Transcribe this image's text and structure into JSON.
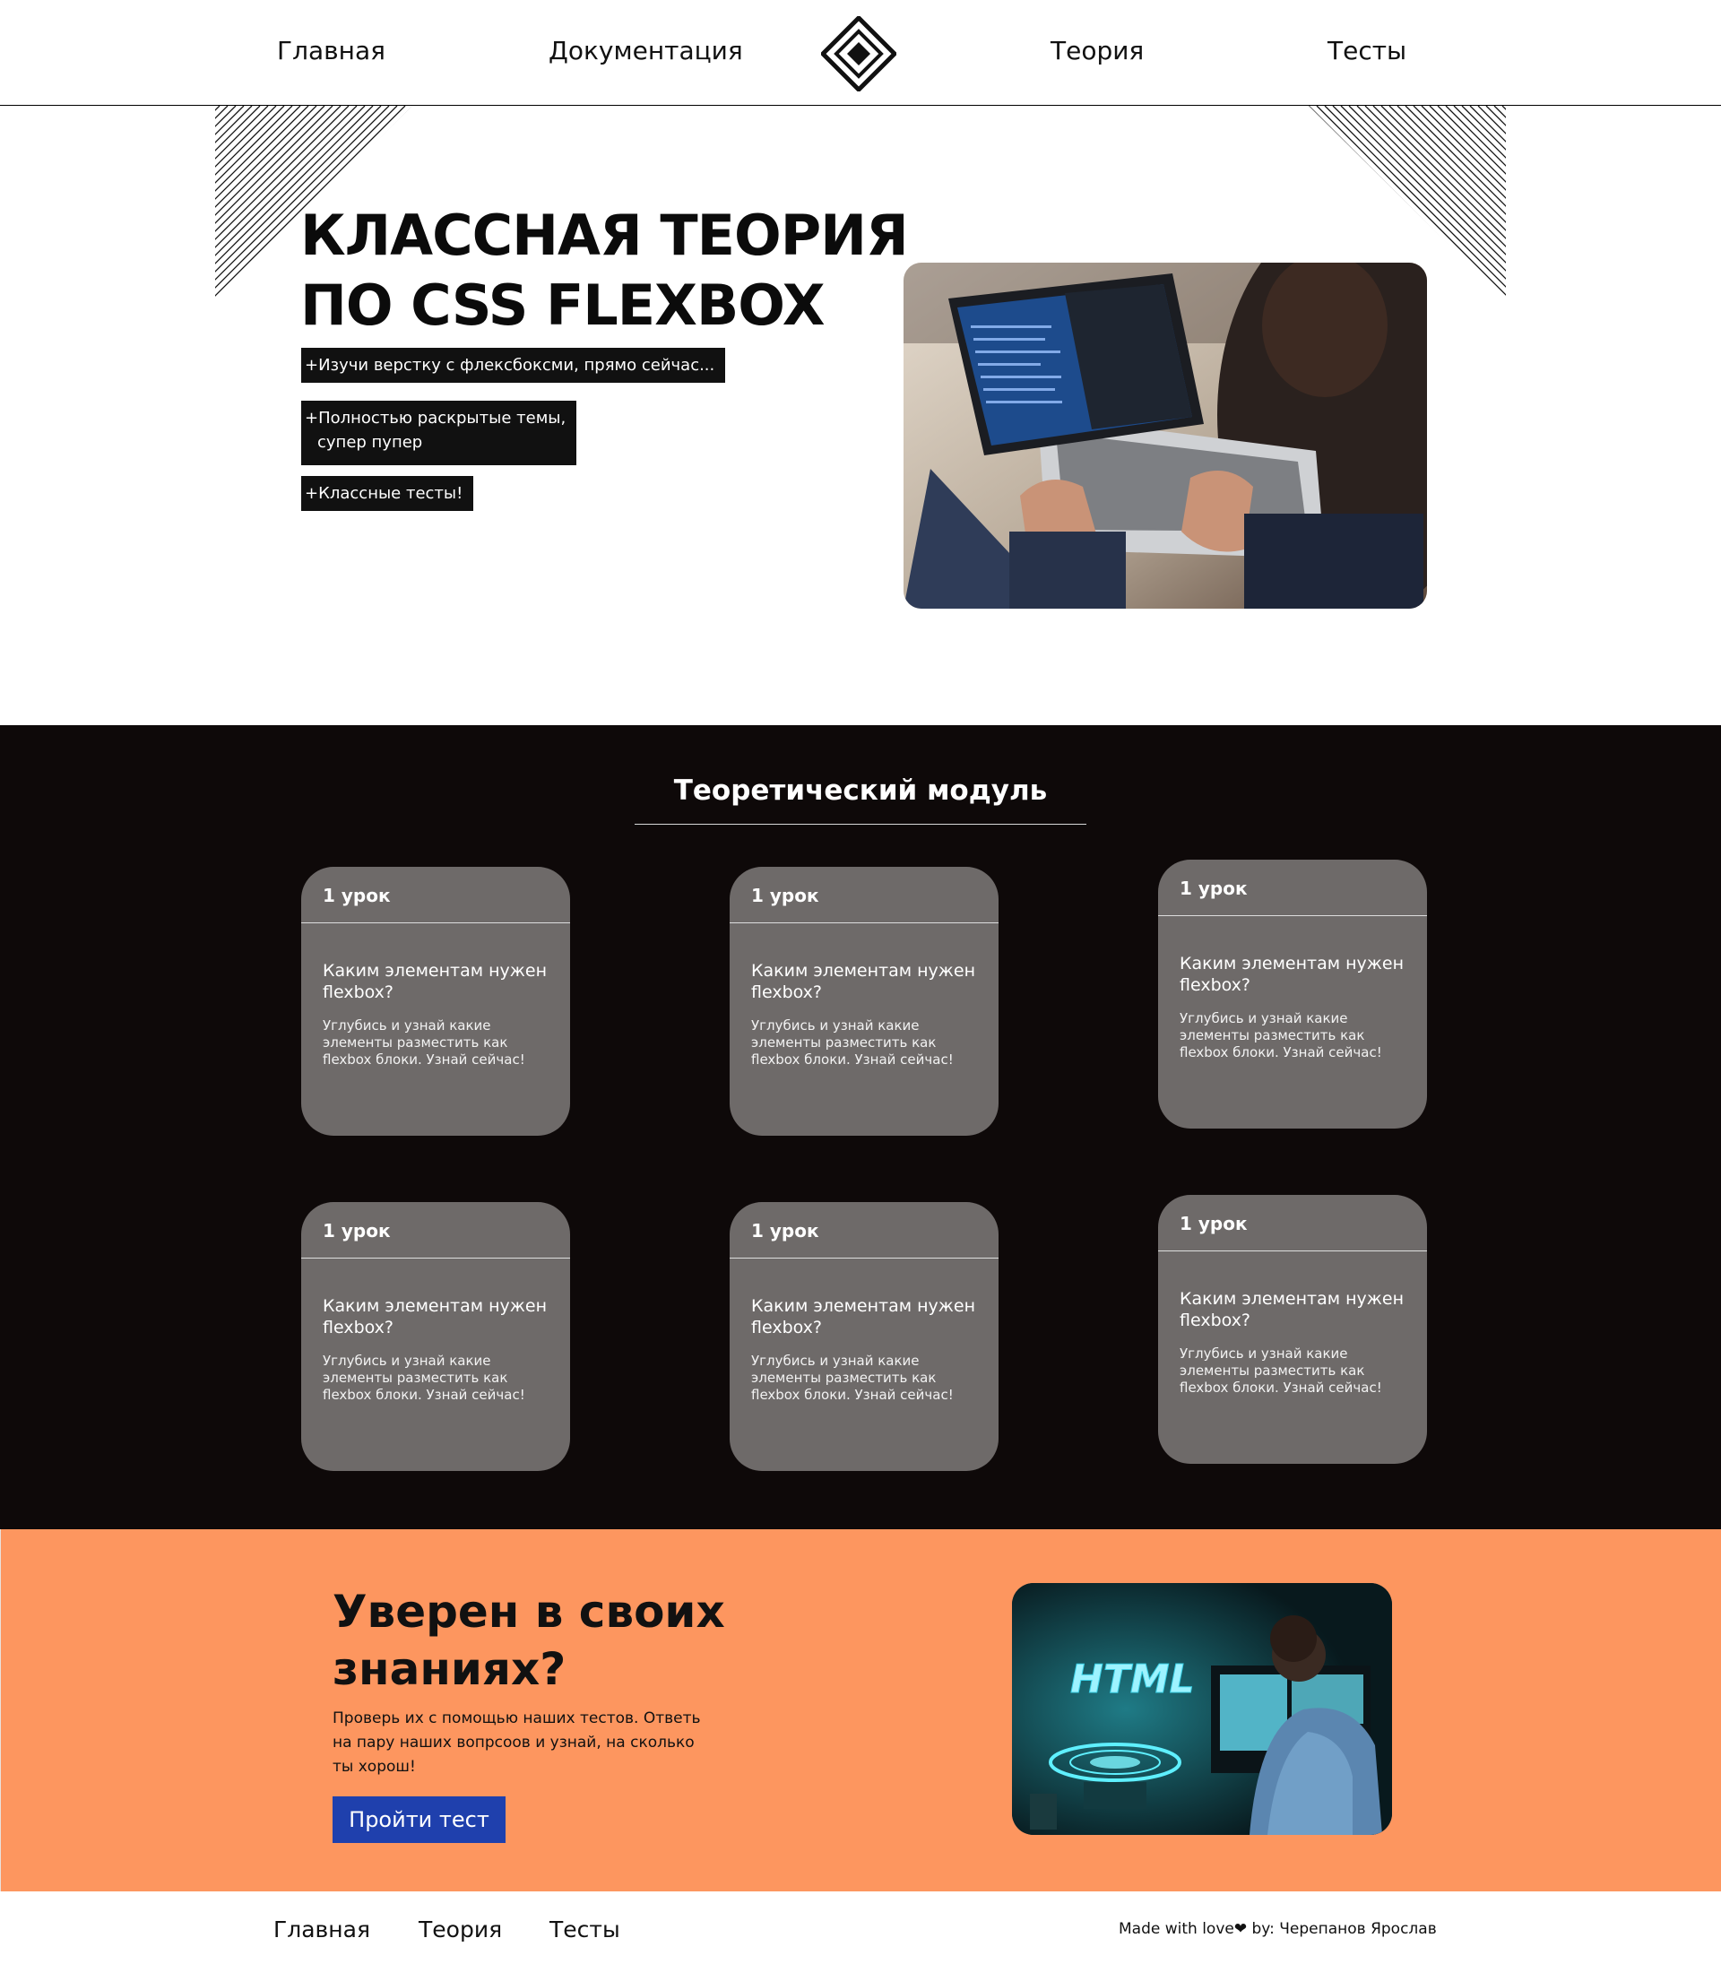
{
  "header": {
    "nav": [
      "Главная",
      "Документация",
      "Теория",
      "Тесты"
    ]
  },
  "hero": {
    "title_line1": "КЛАССНАЯ ТЕОРИЯ",
    "title_line2": "ПО CSS FLEXBOX",
    "bullets": [
      "+Изучи верстку с флексбоксми, прямо сейчас...",
      "+Полностью раскрытые темы,",
      "супер пупер",
      "+Классные тесты!"
    ]
  },
  "module": {
    "title": "Теоретический модуль",
    "cards": [
      {
        "label": "1 урок",
        "heading": "Каким элементам нужен flexbox?",
        "text": "Углубись и узнай какие элементы разместить как flexbox блоки. Узнай сейчас!"
      },
      {
        "label": "1 урок",
        "heading": "Каким элементам нужен flexbox?",
        "text": "Углубись и узнай какие элементы разместить как flexbox блоки. Узнай сейчас!"
      },
      {
        "label": "1 урок",
        "heading": "Каким элементам нужен flexbox?",
        "text": "Углубись и узнай какие элементы разместить как flexbox блоки. Узнай сейчас!"
      },
      {
        "label": "1 урок",
        "heading": "Каким элементам нужен flexbox?",
        "text": "Углубись и узнай какие элементы разместить как flexbox блоки. Узнай сейчас!"
      },
      {
        "label": "1 урок",
        "heading": "Каким элементам нужен flexbox?",
        "text": "Углубись и узнай какие элементы разместить как flexbox блоки. Узнай сейчас!"
      },
      {
        "label": "1 урок",
        "heading": "Каким элементам нужен flexbox?",
        "text": "Углубись и узнай какие элементы разместить как flexbox блоки. Узнай сейчас!"
      }
    ]
  },
  "cta": {
    "title_line1": "Уверен в своих",
    "title_line2": "знаниях?",
    "text": "Проверь их с помощью наших тестов. Ответь на пару наших вопрсоов и узнай, на сколько ты хорош!",
    "button": "Пройти тест",
    "photo_text": "HTML"
  },
  "footer": {
    "links": [
      "Главная",
      "Теория",
      "Тесты"
    ],
    "credit": "Made with love❤ by: Черепанов Ярослав"
  },
  "colors": {
    "dark": "#0e0909",
    "card": "#6e6a69",
    "orange": "#fd965f",
    "button": "#1f40ad"
  }
}
